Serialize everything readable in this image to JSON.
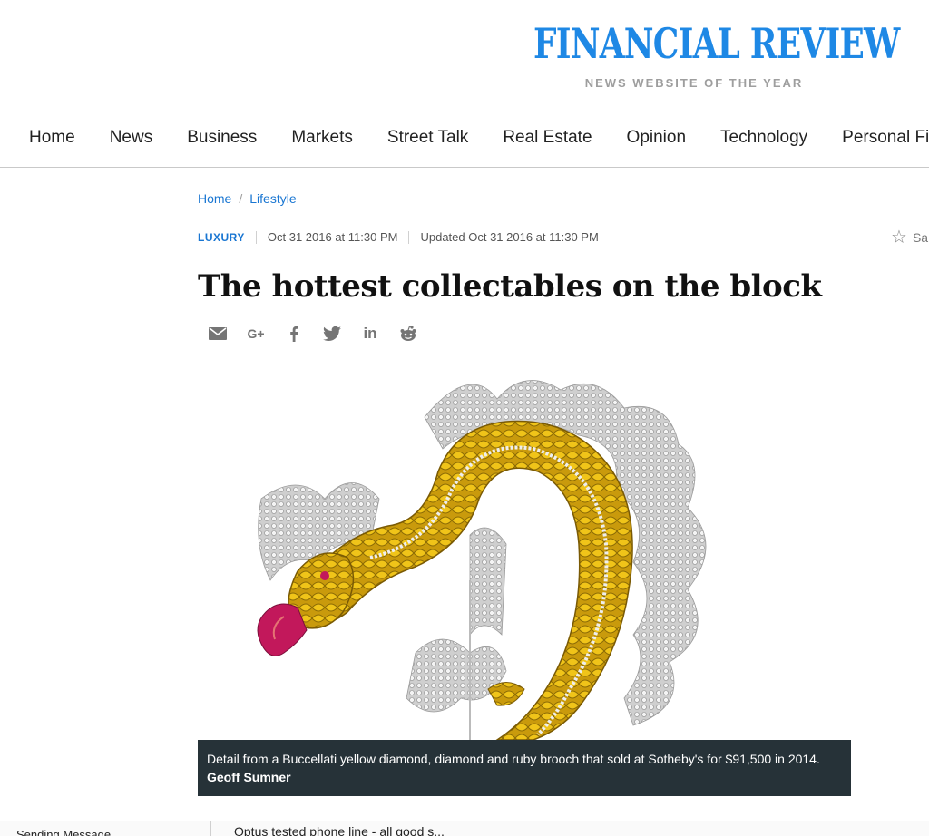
{
  "masthead": {
    "title": "FINANCIAL REVIEW",
    "tagline": "NEWS WEBSITE OF THE YEAR",
    "brand_color": "#1e88e5"
  },
  "nav": {
    "items": [
      "Home",
      "News",
      "Business",
      "Markets",
      "Street Talk",
      "Real Estate",
      "Opinion",
      "Technology",
      "Personal Fi"
    ]
  },
  "breadcrumb": {
    "items": [
      "Home",
      "Lifestyle"
    ],
    "separator": "/"
  },
  "meta": {
    "category": "LUXURY",
    "published": "Oct 31 2016 at 11:30 PM",
    "updated": "Updated Oct 31 2016 at 11:30 PM",
    "save_label": "Sa",
    "save_icon": "star-icon"
  },
  "article": {
    "headline": "The hottest collectables on the block"
  },
  "share": {
    "icons": [
      "email-icon",
      "google-plus-icon",
      "facebook-icon",
      "twitter-icon",
      "linkedin-icon",
      "reddit-icon"
    ],
    "google_plus_label": "G+",
    "linkedin_label": "in"
  },
  "image": {
    "caption": "Detail from a Buccellati yellow diamond, diamond and ruby brooch that sold at Sotheby's for $91,500 in 2014.",
    "credit": "Geoff Sumner"
  },
  "footer_strip": {
    "left_text": "Sending Message",
    "mid_text": "Optus tested phone line - all good s..."
  }
}
